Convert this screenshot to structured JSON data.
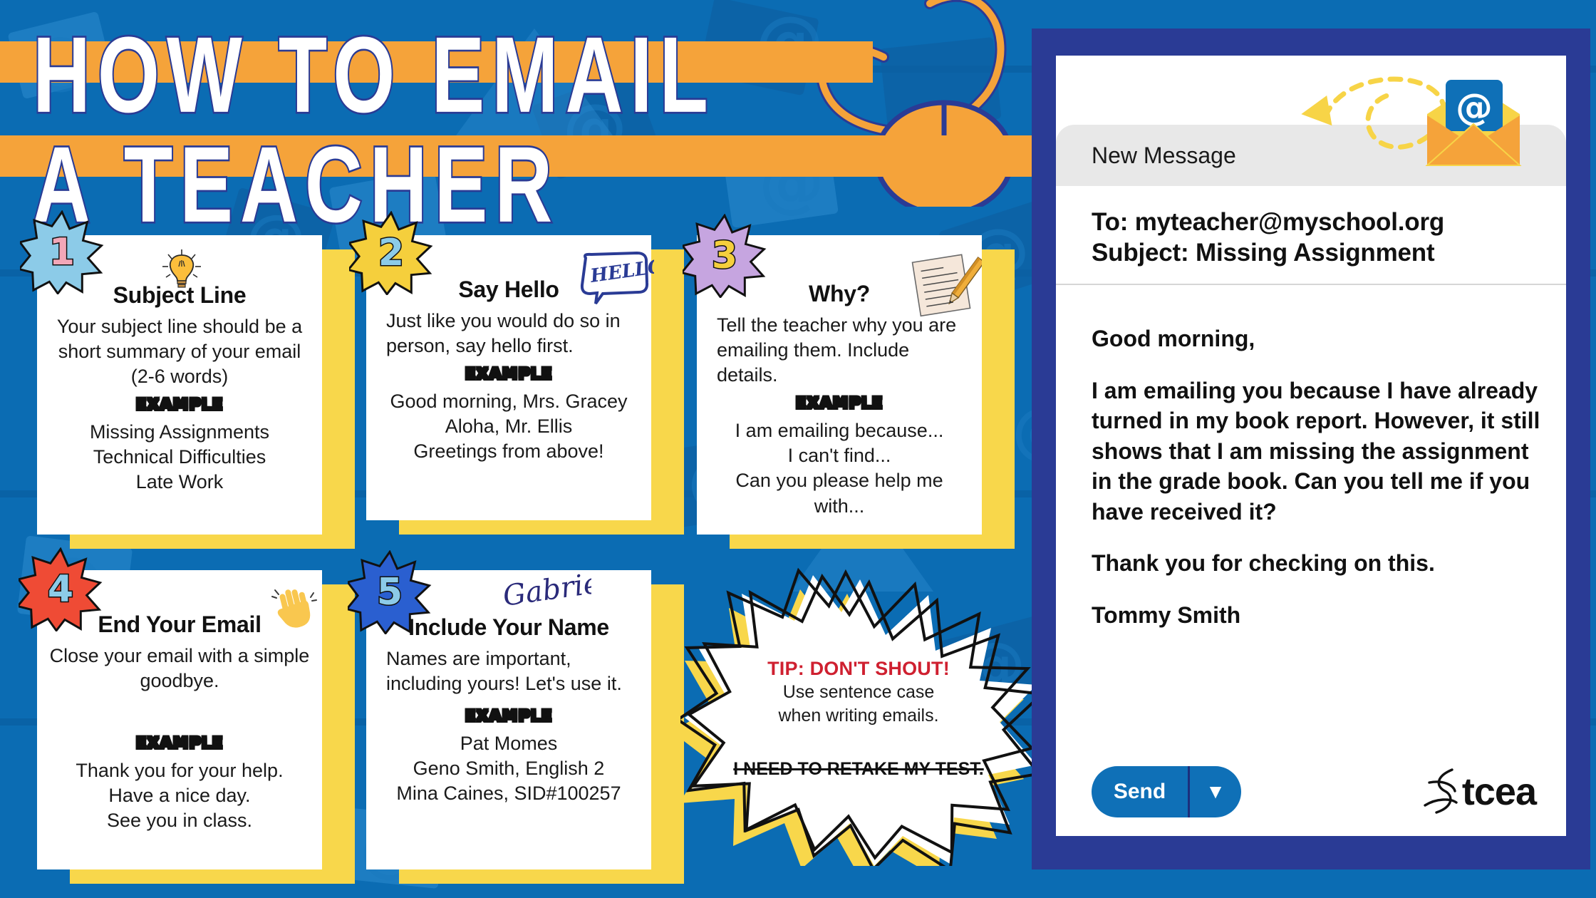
{
  "colors": {
    "background_blue": "#0b6cb3",
    "orange": "#f5a33a",
    "navy": "#2a3b95",
    "yellow": "#f8d74b",
    "red": "#cf2030",
    "send_blue": "#0f70b7"
  },
  "title": {
    "line1": "HOW TO EMAIL",
    "line2": "A TEACHER"
  },
  "cards": [
    {
      "number": "1",
      "star_color": "#8ccbe8",
      "number_color": "#f3a7b8",
      "icon": "lightbulb-icon",
      "heading": "Subject Line",
      "body": "Your subject line should be a short summary of your email (2-6 words)",
      "example_label": "EXAMPLE",
      "examples": [
        "Missing Assignments",
        "Technical Difficulties",
        "Late Work"
      ]
    },
    {
      "number": "2",
      "star_color": "#f5cf3c",
      "number_color": "#8ccbe8",
      "icon": "hello-speech-bubble-icon",
      "icon_text": "HELLO!",
      "heading": "Say Hello",
      "body": "Just like you would do so in person, say hello first.",
      "example_label": "EXAMPLE",
      "examples": [
        "Good morning, Mrs. Gracey",
        "Aloha, Mr. Ellis",
        "Greetings from above!"
      ]
    },
    {
      "number": "3",
      "star_color": "#c6a5e0",
      "number_color": "#f5cf3c",
      "icon": "note-and-pencil-icon",
      "heading": "Why?",
      "body": "Tell the teacher why you are emailing them. Include details.",
      "example_label": "EXAMPLE",
      "examples": [
        "I am emailing because...",
        "I can't find...",
        "Can you please help me with..."
      ]
    },
    {
      "number": "4",
      "star_color": "#ef4b35",
      "number_color": "#8ccbe8",
      "icon": "waving-hand-icon",
      "heading": "End Your Email",
      "body": "Close your email with a simple goodbye.",
      "example_label": "EXAMPLE",
      "examples": [
        "Thank you for your help.",
        "Have a nice day.",
        "See you in class."
      ]
    },
    {
      "number": "5",
      "star_color": "#2a5fd0",
      "number_color": "#8ccbe8",
      "icon": "signature-icon",
      "icon_text": "Gabriel",
      "heading": "Include Your Name",
      "body": "Names are important, including yours! Let's use it.",
      "example_label": "EXAMPLE",
      "examples": [
        "Pat Momes",
        "Geno Smith, English 2",
        "Mina Caines, SID#100257"
      ]
    }
  ],
  "tip_burst": {
    "title": "TIP: DON'T SHOUT!",
    "subtitle_line1": "Use sentence case",
    "subtitle_line2": "when writing emails.",
    "struck_example": "I NEED TO RETAKE MY TEST."
  },
  "email": {
    "window_label": "New Message",
    "to_line": "To: myteacher@myschool.org",
    "subject_line": "Subject: Missing Assignment",
    "body_paragraphs": [
      "Good morning,",
      "I am emailing you because I have already turned in my book report. However, it still shows that I am missing the assignment in the grade book. Can you tell me if you have received it?",
      "Thank you for checking on this.",
      "Tommy Smith"
    ],
    "send_label": "Send",
    "send_caret": "▼",
    "logo_text": "tcea"
  }
}
